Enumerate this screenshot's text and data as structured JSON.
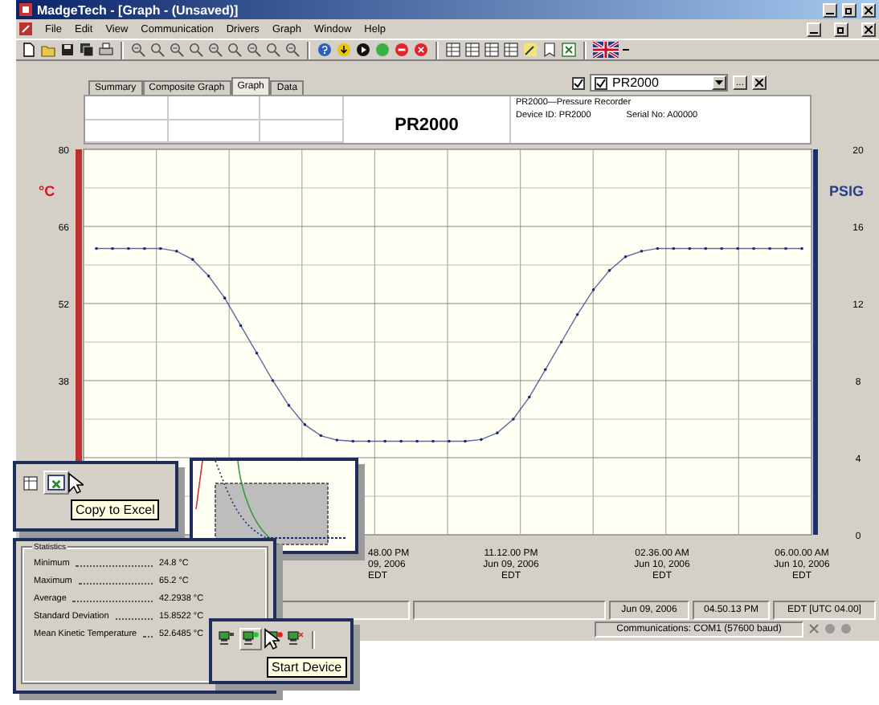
{
  "window": {
    "title": "MadgeTech - [Graph - (Unsaved)]"
  },
  "menu": [
    "File",
    "Edit",
    "View",
    "Communication",
    "Drivers",
    "Graph",
    "Window",
    "Help"
  ],
  "tabs": [
    {
      "label": "Summary",
      "selected": false
    },
    {
      "label": "Composite Graph",
      "selected": false
    },
    {
      "label": "Graph",
      "selected": true
    },
    {
      "label": "Data",
      "selected": false
    }
  ],
  "device_selector": {
    "checked": true,
    "item_checked": true,
    "value": "PR2000",
    "more_button": "..."
  },
  "header": {
    "title": "PR2000",
    "device": "PR2000—Pressure Recorder",
    "device_id": "Device ID: PR2000",
    "serial": "Serial No: A00000"
  },
  "graph": {
    "left_unit": "°C",
    "right_unit": "PSIG",
    "right_ticks": [
      "20",
      "16",
      "12",
      "8",
      "4",
      "0"
    ],
    "chart_data": {
      "type": "line",
      "grid": true,
      "ylim": [
        10,
        80
      ],
      "yticks": [
        38,
        52,
        66,
        80
      ],
      "series": [
        {
          "color": "#1b2a78",
          "values": [
            62,
            62,
            62,
            62,
            62,
            61.5,
            60,
            57,
            53,
            48,
            43,
            38,
            33.5,
            30,
            28,
            27.2,
            27,
            27,
            27,
            27,
            27,
            27,
            27,
            27,
            27.3,
            28.5,
            31,
            35,
            40,
            45,
            50,
            54.5,
            58,
            60.5,
            61.5,
            62,
            62,
            62,
            62,
            62,
            62,
            62,
            62,
            62,
            62
          ]
        }
      ]
    },
    "time_labels": [
      {
        "time": "48.00 PM",
        "date": "09, 2006",
        "zone": "EDT"
      },
      {
        "time": "11.12.00 PM",
        "date": "Jun 09, 2006",
        "zone": "EDT"
      },
      {
        "time": "02.36.00 AM",
        "date": "Jun 10, 2006",
        "zone": "EDT"
      },
      {
        "time": "06.00.00 AM",
        "date": "Jun 10, 2006",
        "zone": "EDT"
      }
    ]
  },
  "status_bar": {
    "date": "Jun 09, 2006",
    "time": "04.50.13 PM",
    "zone": "EDT [UTC 04.00]",
    "communications": "Communications: COM1 (57600 baud)"
  },
  "copy_callout": {
    "tooltip": "Copy to Excel"
  },
  "statistics": {
    "title": "Statistics",
    "rows": [
      {
        "label": "Minimum",
        "value": "24.8 °C"
      },
      {
        "label": "Maximum",
        "value": "65.2 °C"
      },
      {
        "label": "Average",
        "value": "42.2938 °C"
      },
      {
        "label": "Standard Deviation",
        "value": "15.8522 °C"
      },
      {
        "label": "Mean Kinetic Temperature",
        "value": "52.6485 °C"
      }
    ]
  },
  "device_callout": {
    "tooltip": "Start Device"
  }
}
